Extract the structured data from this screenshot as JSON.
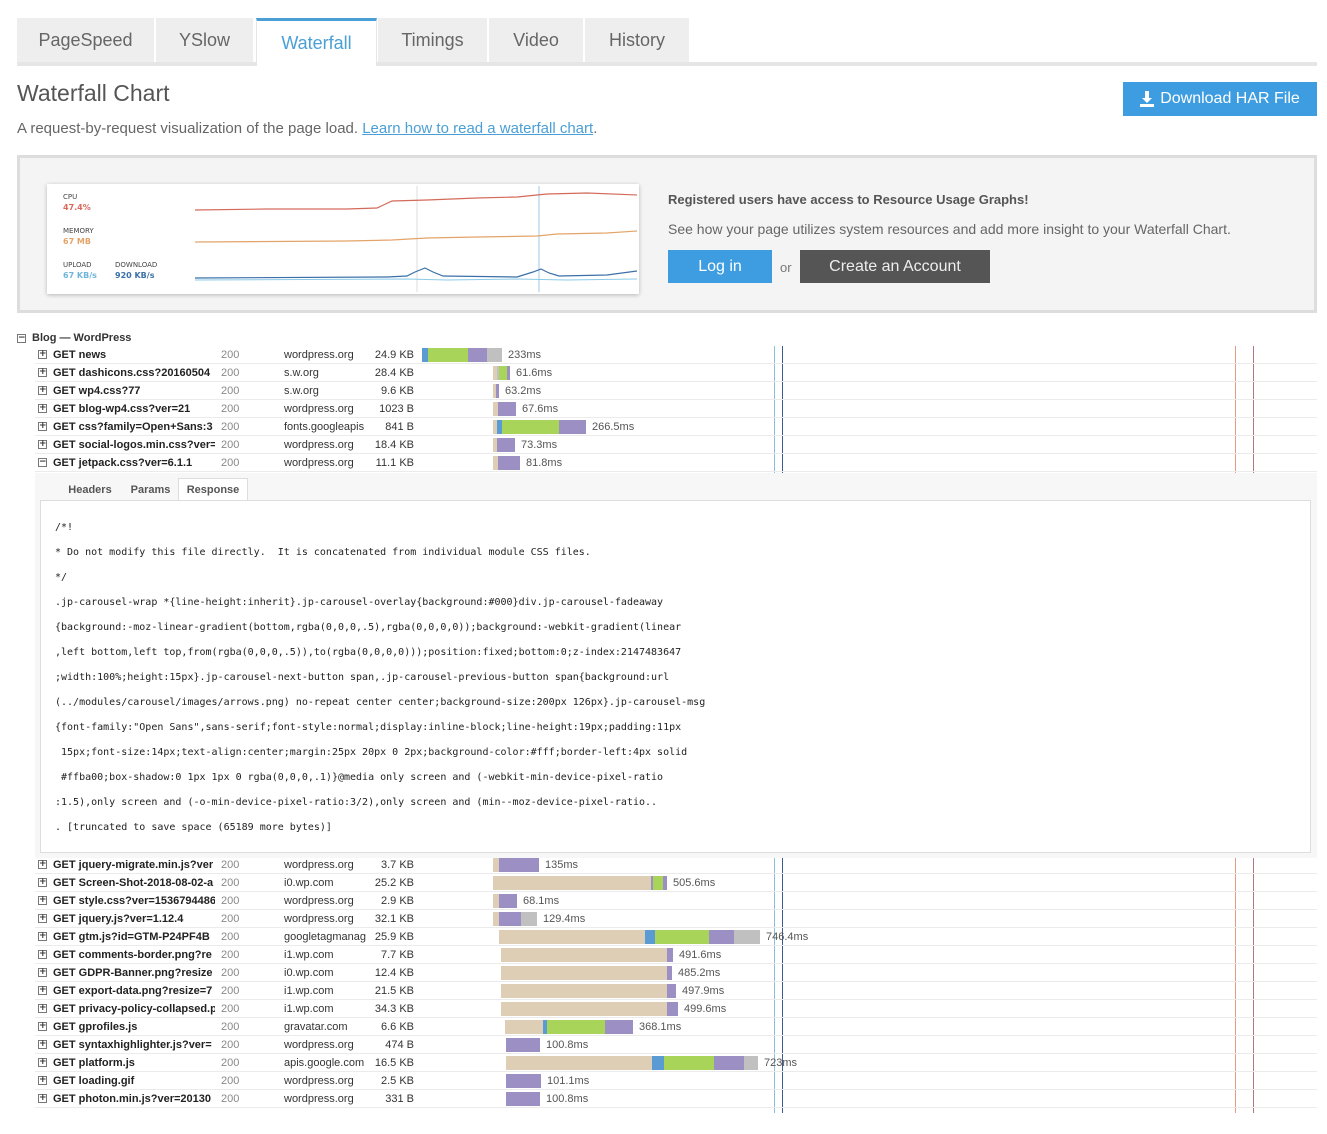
{
  "tabs": [
    {
      "label": "PageSpeed",
      "active": false
    },
    {
      "label": "YSlow",
      "active": false
    },
    {
      "label": "Waterfall",
      "active": true
    },
    {
      "label": "Timings",
      "active": false
    },
    {
      "label": "Video",
      "active": false
    },
    {
      "label": "History",
      "active": false
    }
  ],
  "header": {
    "title": "Waterfall Chart",
    "description": "A request-by-request visualization of the page load. ",
    "learn_link": "Learn how to read a waterfall chart",
    "period": ".",
    "download_label": "Download HAR File"
  },
  "promo": {
    "cpu_label": "CPU",
    "cpu_value": "47.4%",
    "memory_label": "MEMORY",
    "memory_value": "67 MB",
    "upload_label": "UPLOAD",
    "upload_value": "67 KB/s",
    "download_label": "DOWNLOAD",
    "download_value": "920 KB/s",
    "heading": "Registered users have access to Resource Usage Graphs!",
    "subtext": "See how your page utilizes system resources and add more insight to your Waterfall Chart.",
    "login_label": "Log in",
    "or_label": "or",
    "create_label": "Create an Account"
  },
  "colors": {
    "blocking": "#ddceb5",
    "dns": "#1fa3a3",
    "connect": "#5a9bd4",
    "send": "#f0a030",
    "wait": "#a8d45a",
    "receive": "#9b8fc4",
    "other": "#c0c0c0",
    "accent": "#3e9de1"
  },
  "group_title": "Blog — WordPress",
  "requests_top": [
    {
      "name": "GET news",
      "status": "200",
      "domain": "wordpress.org",
      "size": "24.9 KB",
      "time": "233ms",
      "expanded": false
    },
    {
      "name": "GET dashicons.css?20160504",
      "status": "200",
      "domain": "s.w.org",
      "size": "28.4 KB",
      "time": "61.6ms",
      "expanded": false
    },
    {
      "name": "GET wp4.css?77",
      "status": "200",
      "domain": "s.w.org",
      "size": "9.6 KB",
      "time": "63.2ms",
      "expanded": false
    },
    {
      "name": "GET blog-wp4.css?ver=21",
      "status": "200",
      "domain": "wordpress.org",
      "size": "1023 B",
      "time": "67.6ms",
      "expanded": false
    },
    {
      "name": "GET css?family=Open+Sans:3",
      "status": "200",
      "domain": "fonts.googleapis",
      "size": "841 B",
      "time": "266.5ms",
      "expanded": false
    },
    {
      "name": "GET social-logos.min.css?ver=",
      "status": "200",
      "domain": "wordpress.org",
      "size": "18.4 KB",
      "time": "73.3ms",
      "expanded": false
    },
    {
      "name": "GET jetpack.css?ver=6.1.1",
      "status": "200",
      "domain": "wordpress.org",
      "size": "11.1 KB",
      "time": "81.8ms",
      "expanded": true
    }
  ],
  "detail_tabs": [
    "Headers",
    "Params",
    "Response"
  ],
  "response_lines": [
    "/*!",
    "* Do not modify this file directly.  It is concatenated from individual module CSS files.",
    "*/",
    ".jp-carousel-wrap *{line-height:inherit}.jp-carousel-overlay{background:#000}div.jp-carousel-fadeaway",
    "{background:-moz-linear-gradient(bottom,rgba(0,0,0,.5),rgba(0,0,0,0));background:-webkit-gradient(linear",
    ",left bottom,left top,from(rgba(0,0,0,.5)),to(rgba(0,0,0,0)));position:fixed;bottom:0;z-index:2147483647",
    ";width:100%;height:15px}.jp-carousel-next-button span,.jp-carousel-previous-button span{background:url",
    "(../modules/carousel/images/arrows.png) no-repeat center center;background-size:200px 126px}.jp-carousel-msg",
    "{font-family:\"Open Sans\",sans-serif;font-style:normal;display:inline-block;line-height:19px;padding:11px",
    " 15px;font-size:14px;text-align:center;margin:25px 20px 0 2px;background-color:#fff;border-left:4px solid",
    " #ffba00;box-shadow:0 1px 1px 0 rgba(0,0,0,.1)}@media only screen and (-webkit-min-device-pixel-ratio",
    ":1.5),only screen and (-o-min-device-pixel-ratio:3/2),only screen and (min--moz-device-pixel-ratio..",
    ". [truncated to save space (65189 more bytes)]"
  ],
  "requests_bottom": [
    {
      "name": "GET jquery-migrate.min.js?ver",
      "status": "200",
      "domain": "wordpress.org",
      "size": "3.7 KB",
      "time": "135ms"
    },
    {
      "name": "GET Screen-Shot-2018-08-02-a",
      "status": "200",
      "domain": "i0.wp.com",
      "size": "25.2 KB",
      "time": "505.6ms"
    },
    {
      "name": "GET style.css?ver=1536794486",
      "status": "200",
      "domain": "wordpress.org",
      "size": "2.9 KB",
      "time": "68.1ms"
    },
    {
      "name": "GET jquery.js?ver=1.12.4",
      "status": "200",
      "domain": "wordpress.org",
      "size": "32.1 KB",
      "time": "129.4ms"
    },
    {
      "name": "GET gtm.js?id=GTM-P24PF4B",
      "status": "200",
      "domain": "googletagmanag",
      "size": "25.9 KB",
      "time": "746.4ms"
    },
    {
      "name": "GET comments-border.png?re",
      "status": "200",
      "domain": "i1.wp.com",
      "size": "7.7 KB",
      "time": "491.6ms"
    },
    {
      "name": "GET GDPR-Banner.png?resize",
      "status": "200",
      "domain": "i0.wp.com",
      "size": "12.4 KB",
      "time": "485.2ms"
    },
    {
      "name": "GET export-data.png?resize=7",
      "status": "200",
      "domain": "i1.wp.com",
      "size": "21.5 KB",
      "time": "497.9ms"
    },
    {
      "name": "GET privacy-policy-collapsed.p",
      "status": "200",
      "domain": "i1.wp.com",
      "size": "34.3 KB",
      "time": "499.6ms"
    },
    {
      "name": "GET gprofiles.js",
      "status": "200",
      "domain": "gravatar.com",
      "size": "6.6 KB",
      "time": "368.1ms"
    },
    {
      "name": "GET syntaxhighlighter.js?ver=",
      "status": "200",
      "domain": "wordpress.org",
      "size": "474 B",
      "time": "100.8ms"
    },
    {
      "name": "GET platform.js",
      "status": "200",
      "domain": "apis.google.com",
      "size": "16.5 KB",
      "time": "723ms"
    },
    {
      "name": "GET loading.gif",
      "status": "200",
      "domain": "wordpress.org",
      "size": "2.5 KB",
      "time": "101.1ms"
    },
    {
      "name": "GET photon.min.js?ver=20130",
      "status": "200",
      "domain": "wordpress.org",
      "size": "331 B",
      "time": "100.8ms"
    }
  ]
}
